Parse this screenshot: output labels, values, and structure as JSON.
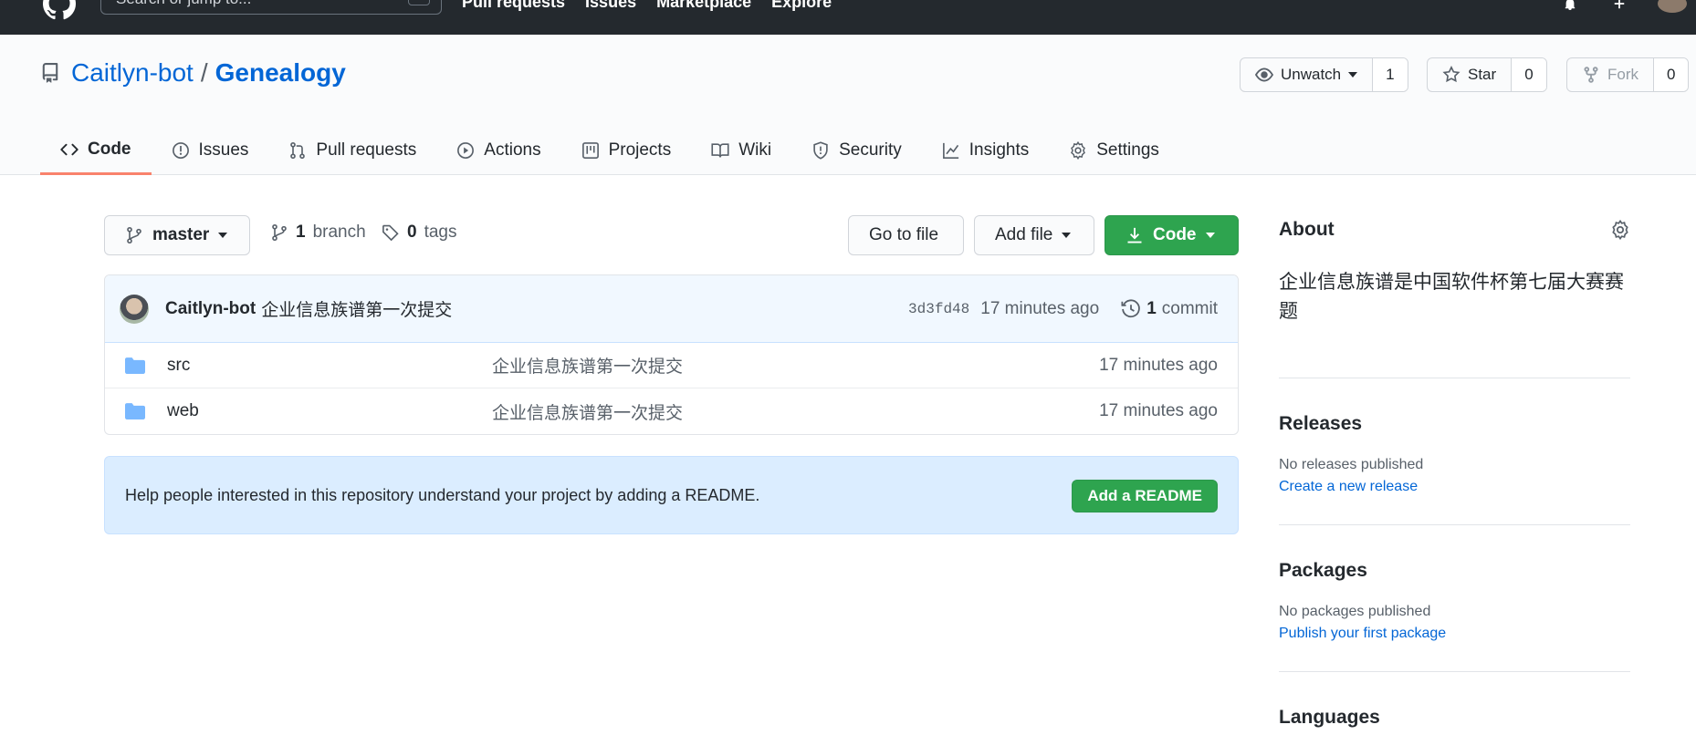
{
  "header": {
    "search_placeholder": "Search or jump to...",
    "nav": [
      "Pull requests",
      "Issues",
      "Marketplace",
      "Explore"
    ]
  },
  "repo": {
    "owner": "Caitlyn-bot",
    "separator": "/",
    "name": "Genealogy",
    "watch_label": "Unwatch",
    "watch_count": "1",
    "star_label": "Star",
    "star_count": "0",
    "fork_label": "Fork",
    "fork_count": "0"
  },
  "tabs": [
    {
      "label": "Code",
      "icon": "code-icon",
      "active": true
    },
    {
      "label": "Issues",
      "icon": "issue-icon"
    },
    {
      "label": "Pull requests",
      "icon": "pull-request-icon"
    },
    {
      "label": "Actions",
      "icon": "play-icon"
    },
    {
      "label": "Projects",
      "icon": "project-icon"
    },
    {
      "label": "Wiki",
      "icon": "book-icon"
    },
    {
      "label": "Security",
      "icon": "shield-icon"
    },
    {
      "label": "Insights",
      "icon": "graph-icon"
    },
    {
      "label": "Settings",
      "icon": "gear-icon"
    }
  ],
  "toolbar": {
    "branch": "master",
    "branch_count": "1",
    "branch_label": "branch",
    "tag_count": "0",
    "tag_label": "tags",
    "goto_file": "Go to file",
    "add_file": "Add file",
    "code": "Code"
  },
  "commit": {
    "author": "Caitlyn-bot",
    "message": "企业信息族谱第一次提交",
    "sha": "3d3fd48",
    "age": "17 minutes ago",
    "count": "1",
    "count_label": "commit"
  },
  "files": [
    {
      "name": "src",
      "message": "企业信息族谱第一次提交",
      "age": "17 minutes ago"
    },
    {
      "name": "web",
      "message": "企业信息族谱第一次提交",
      "age": "17 minutes ago"
    }
  ],
  "readme": {
    "text": "Help people interested in this repository understand your project by adding a README.",
    "button": "Add a README"
  },
  "sidebar": {
    "about_title": "About",
    "about_desc": "企业信息族谱是中国软件杯第七届大赛赛题",
    "releases_title": "Releases",
    "releases_none": "No releases published",
    "releases_link": "Create a new release",
    "packages_title": "Packages",
    "packages_none": "No packages published",
    "packages_link": "Publish your first package",
    "languages_title": "Languages"
  },
  "colors": {
    "primary_green": "#2ea44f",
    "link_blue": "#0366d6",
    "active_tab_underline": "#f9826c",
    "folder_blue": "#79b8ff"
  }
}
